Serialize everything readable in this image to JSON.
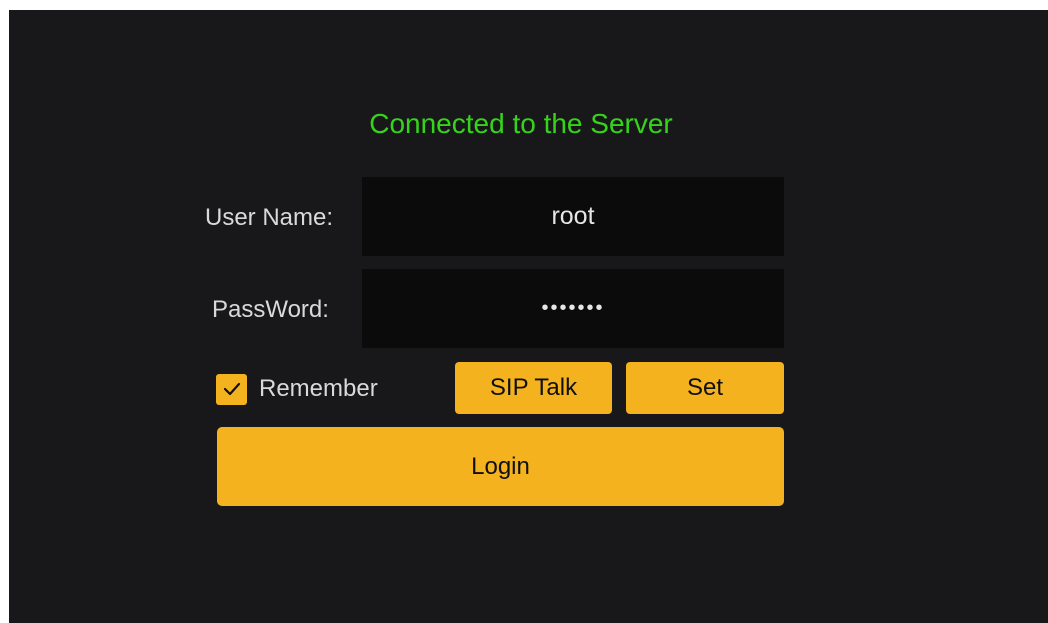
{
  "status": {
    "text": "Connected to the Server",
    "color": "#35d41a"
  },
  "form": {
    "username_label": "User Name:",
    "username_value": "root",
    "password_label": "PassWord:",
    "password_value": "•••••••"
  },
  "remember": {
    "label": "Remember",
    "checked": true
  },
  "buttons": {
    "sip_talk": "SIP Talk",
    "set": "Set",
    "login": "Login"
  },
  "colors": {
    "background": "#18181a",
    "field_background": "#0b0b0b",
    "accent": "#f5b21f"
  },
  "icons": {
    "checkbox": "check-icon"
  }
}
